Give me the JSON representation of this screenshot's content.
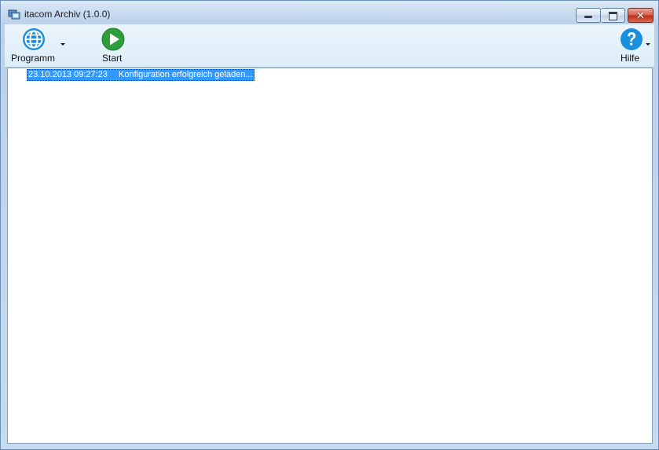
{
  "window": {
    "title": "itacom Archiv (1.0.0)",
    "close_glyph": "✕"
  },
  "toolbar": {
    "programm_label": "Programm",
    "start_label": "Start",
    "hilfe_label": "Hilfe"
  },
  "log": {
    "entries": [
      {
        "time": "23.10.2013 09:27:23",
        "message": "Konfiguration erfolgreich geladen..."
      }
    ]
  },
  "colors": {
    "selection": "#3399ff",
    "globe": "#1f8fd6",
    "start": "#2e9e3a",
    "help": "#1a8fe0",
    "close_button": "#c8351c"
  },
  "icons": {
    "app": "app-icon",
    "programm": "globe-icon",
    "start": "play-icon",
    "hilfe": "help-icon"
  }
}
